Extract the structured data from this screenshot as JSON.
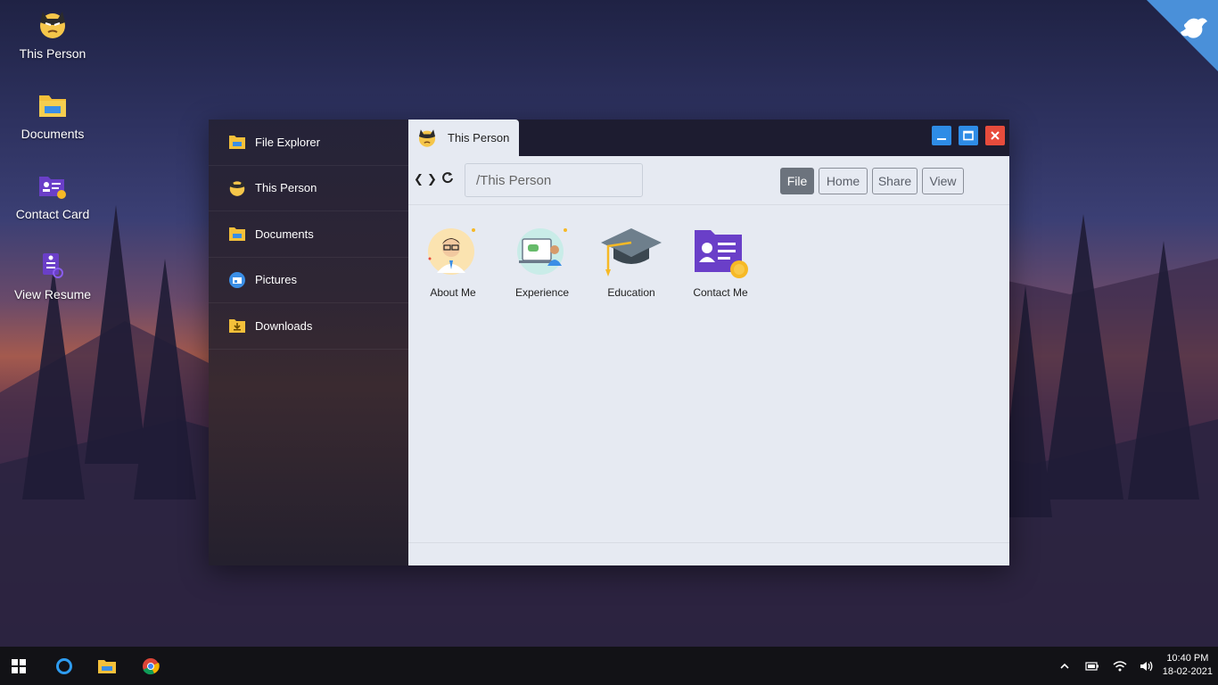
{
  "desktop": {
    "icons": [
      {
        "label": "This Person",
        "icon": "batman-icon"
      },
      {
        "label": "Documents",
        "icon": "folder-icon"
      },
      {
        "label": "Contact Card",
        "icon": "contact-card-icon"
      },
      {
        "label": "View Resume",
        "icon": "resume-icon"
      }
    ]
  },
  "sidebar": {
    "items": [
      {
        "label": "File Explorer",
        "icon": "folder-icon"
      },
      {
        "label": "This Person",
        "icon": "batman-icon"
      },
      {
        "label": "Documents",
        "icon": "folder-icon"
      },
      {
        "label": "Pictures",
        "icon": "pictures-icon"
      },
      {
        "label": "Downloads",
        "icon": "downloads-folder-icon"
      }
    ]
  },
  "window": {
    "tab_title": "This Person",
    "address": "/This Person",
    "toolbar_buttons": [
      "File",
      "Home",
      "Share",
      "View"
    ],
    "active_toolbar_button": "File",
    "files": [
      {
        "label": "About Me",
        "icon": "avatar-icon"
      },
      {
        "label": "Experience",
        "icon": "presentation-icon"
      },
      {
        "label": "Education",
        "icon": "graduation-cap-icon"
      },
      {
        "label": "Contact Me",
        "icon": "contact-card-icon"
      }
    ]
  },
  "taskbar": {
    "time": "10:40 PM",
    "date": "18-02-2021"
  },
  "colors": {
    "accent_blue": "#2e8ce6",
    "close_red": "#e74c3c",
    "folder_yellow": "#f4c03a",
    "contact_purple": "#6a3fc8"
  }
}
